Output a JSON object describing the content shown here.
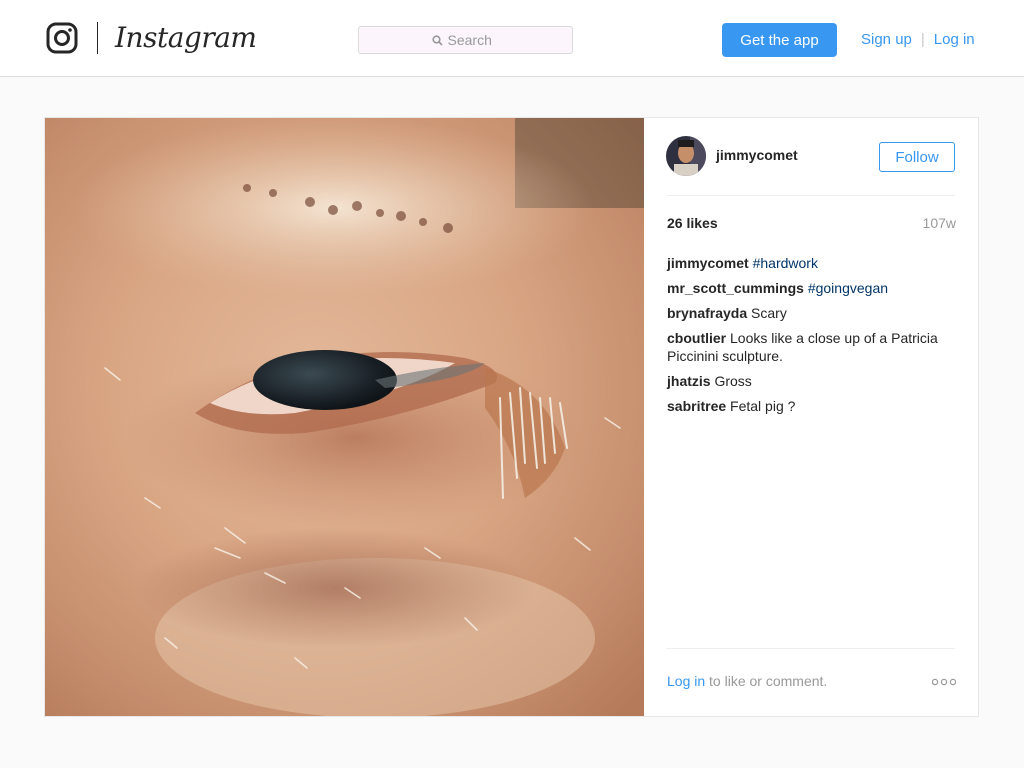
{
  "header": {
    "logo_text": "Instagram",
    "search_placeholder": "Search",
    "get_app_label": "Get the app",
    "sign_up_label": "Sign up",
    "separator": "|",
    "log_in_label": "Log in"
  },
  "post": {
    "username": "jimmycomet",
    "follow_label": "Follow",
    "likes": "26 likes",
    "age": "107w",
    "comments": [
      {
        "author": "jimmycomet",
        "text": "",
        "tag": "#hardwork"
      },
      {
        "author": "mr_scott_cummings",
        "text": "",
        "tag": "#goingvegan"
      },
      {
        "author": "brynafrayda",
        "text": "Scary",
        "tag": ""
      },
      {
        "author": "cboutlier",
        "text": "Looks like a close up of a Patricia Piccinini sculpture.",
        "tag": ""
      },
      {
        "author": "jhatzis",
        "text": "Gross",
        "tag": ""
      },
      {
        "author": "sabritree",
        "text": "Fetal pig ?",
        "tag": ""
      }
    ],
    "footer_login": "Log in",
    "footer_text": " to like or comment."
  },
  "colors": {
    "accent": "#3897f0",
    "hashtag": "#003569",
    "background": "#fafafa"
  },
  "icons": [
    "instagram-camera-icon",
    "search-icon",
    "more-options-icon"
  ]
}
